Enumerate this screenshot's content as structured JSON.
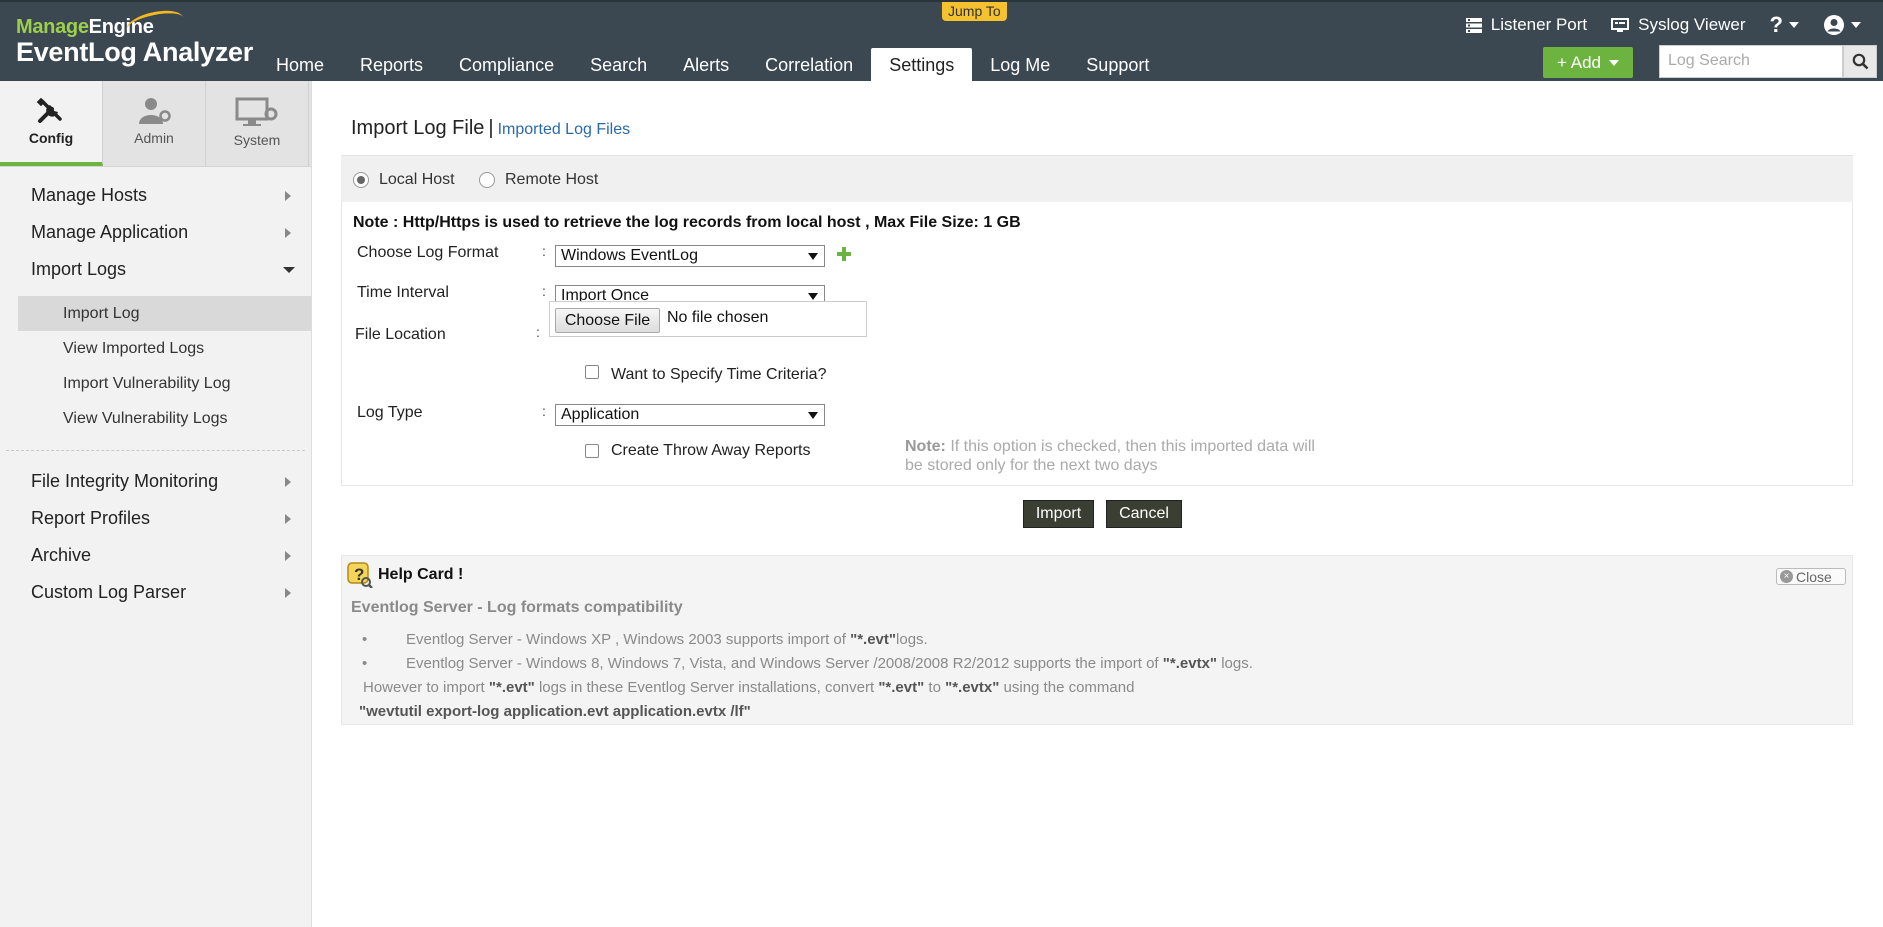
{
  "header": {
    "brand_manage": "Manage",
    "brand_engine": "Engine",
    "product": "EventLog Analyzer",
    "jump_to": "Jump To",
    "nav": [
      {
        "label": "Home"
      },
      {
        "label": "Reports"
      },
      {
        "label": "Compliance"
      },
      {
        "label": "Search"
      },
      {
        "label": "Alerts"
      },
      {
        "label": "Correlation"
      },
      {
        "label": "Settings"
      },
      {
        "label": "Log Me"
      },
      {
        "label": "Support"
      }
    ],
    "active_nav": "Settings",
    "listener_port": "Listener Port",
    "syslog_viewer": "Syslog Viewer",
    "help": "?",
    "add_button": "+ Add",
    "search_placeholder": "Log Search",
    "accent_color": "#6db33f"
  },
  "sidebar": {
    "tabs": [
      {
        "label": "Config"
      },
      {
        "label": "Admin"
      },
      {
        "label": "System"
      }
    ],
    "active_tab": "Config",
    "menu": [
      {
        "label": "Manage Hosts"
      },
      {
        "label": "Manage Application"
      },
      {
        "label": "Import Logs"
      }
    ],
    "submenu": [
      {
        "label": "Import Log"
      },
      {
        "label": "View Imported Logs"
      },
      {
        "label": "Import Vulnerability Log"
      },
      {
        "label": "View Vulnerability Logs"
      }
    ],
    "active_sub": "Import Log",
    "menu2": [
      {
        "label": "File Integrity Monitoring"
      },
      {
        "label": "Report Profiles"
      },
      {
        "label": "Archive"
      },
      {
        "label": "Custom Log Parser"
      }
    ]
  },
  "main": {
    "title": "Import Log File",
    "title_sep": "|",
    "imported_link": "Imported Log Files",
    "host_options": [
      {
        "label": "Local Host",
        "selected": true
      },
      {
        "label": "Remote Host",
        "selected": false
      }
    ],
    "note": "Note : Http/Https is used to retrieve the log records from local host , Max File Size: 1 GB",
    "form": {
      "log_format_label": "Choose Log Format",
      "log_format_value": "Windows EventLog",
      "time_interval_label": "Time Interval",
      "time_interval_value": "Import Once",
      "file_location_label": "File Location",
      "choose_file": "Choose File",
      "no_file": "No file chosen",
      "time_criteria_label": "Want to Specify Time Criteria?",
      "log_type_label": "Log Type",
      "log_type_value": "Application",
      "throw_away_label": "Create Throw Away Reports",
      "throw_away_note_prefix": "Note:",
      "throw_away_note": " If this option is checked, then this imported data will be stored only for the next two days"
    },
    "import_button": "Import",
    "cancel_button": "Cancel"
  },
  "help_card": {
    "title": "Help Card !",
    "close": "Close",
    "subtitle": "Eventlog Server - Log formats compatibility",
    "item1_text": "Eventlog Server - Windows XP , Windows 2003 supports import of ",
    "item1_bold": "\"*.evt\"",
    "item1_end": "logs.",
    "item2_text": "Eventlog Server - Windows 8, Windows 7, Vista, and Windows Server /2008/2008 R2/2012 supports the import of ",
    "item2_bold": "\"*.evtx\"",
    "item2_end": " logs.",
    "line3_a": "However to import ",
    "line3_b": "\"*.evt\"",
    "line3_c": " logs in these Eventlog Server installations, convert ",
    "line3_d": "\"*.evt\"",
    "line3_e": " to ",
    "line3_f": "\"*.evtx\"",
    "line3_g": " using the command",
    "command": "\"wevtutil export-log application.evt application.evtx /lf\""
  }
}
